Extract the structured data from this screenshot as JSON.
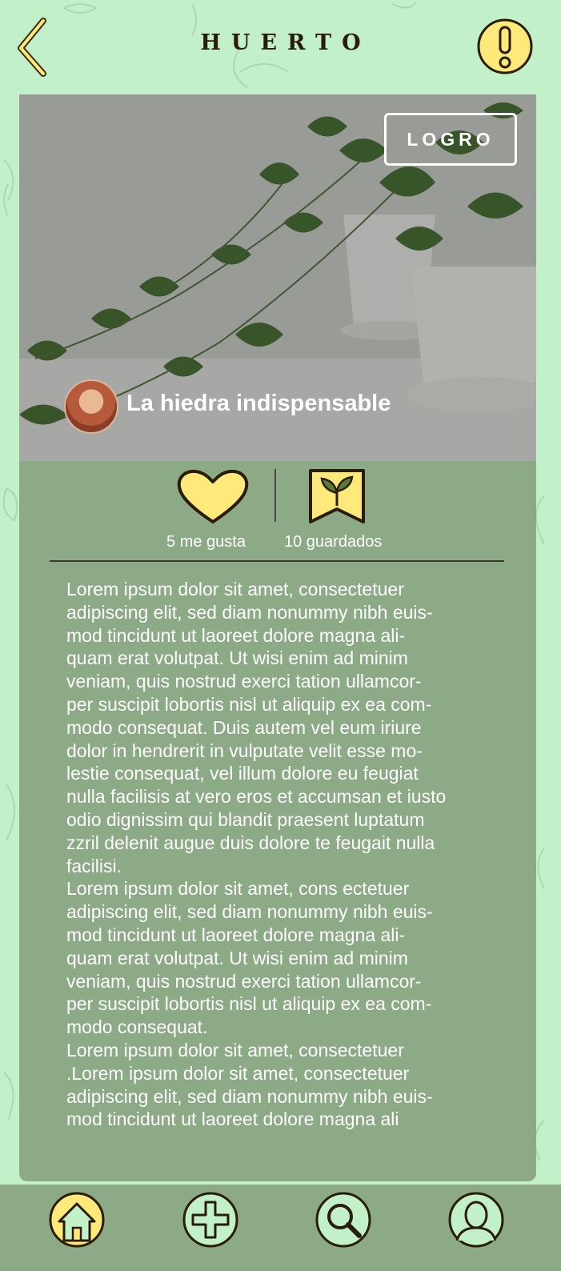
{
  "header": {
    "title": "HUERTO",
    "back_icon": "chevron-left-icon",
    "alert_icon": "exclamation-icon"
  },
  "post": {
    "achievement_label": "LOGRO",
    "title": "La hiedra indispensable",
    "likes_label": "5 me gusta",
    "saves_label": "10 guardados",
    "paragraphs": [
      "Lorem ipsum dolor sit amet, consectetuer\nadipiscing elit, sed diam nonummy nibh euis-\nmod tincidunt ut laoreet dolore magna ali-\nquam erat volutpat. Ut wisi enim ad minim\nveniam, quis nostrud exerci tation ullamcor-\nper suscipit lobortis nisl ut aliquip ex ea com-\nmodo consequat. Duis autem vel eum iriure\ndolor in hendrerit in vulputate velit esse mo-\nlestie consequat, vel illum dolore eu feugiat\nnulla facilisis at vero eros et accumsan et iusto\nodio dignissim qui blandit praesent luptatum\nzzril delenit augue duis dolore te feugait nulla\nfacilisi.",
      "Lorem ipsum dolor sit amet, cons ectetuer\nadipiscing elit, sed diam nonummy nibh euis-\nmod tincidunt ut laoreet dolore magna ali-\nquam erat volutpat. Ut wisi enim ad minim\nveniam, quis nostrud exerci tation ullamcor-\nper suscipit lobortis nisl ut aliquip ex ea com-\nmodo consequat.",
      "Lorem ipsum dolor sit amet, consectetuer\n.Lorem ipsum dolor sit amet, consectetuer\nadipiscing elit, sed diam nonummy nibh euis-\nmod tincidunt ut laoreet dolore magna ali"
    ]
  },
  "nav": {
    "items": [
      "home-icon",
      "add-icon",
      "search-icon",
      "profile-icon"
    ]
  },
  "colors": {
    "background": "#c2f0c8",
    "card": "#8daa86",
    "accent_yellow": "#ffe97a",
    "ink": "#2a1d08"
  }
}
